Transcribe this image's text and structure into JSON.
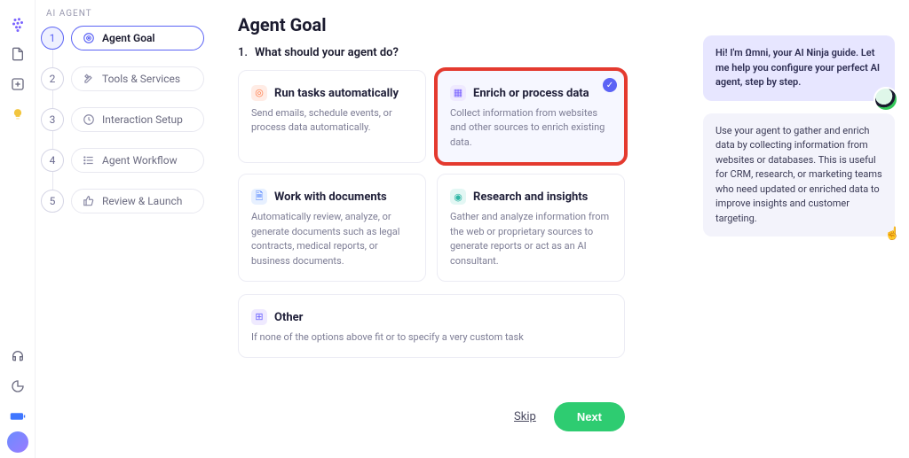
{
  "brand": "AI AGENT",
  "steps": [
    {
      "num": "1",
      "label": "Agent Goal",
      "icon": "target"
    },
    {
      "num": "2",
      "label": "Tools & Services",
      "icon": "tools"
    },
    {
      "num": "3",
      "label": "Interaction Setup",
      "icon": "clock"
    },
    {
      "num": "4",
      "label": "Agent Workflow",
      "icon": "list"
    },
    {
      "num": "5",
      "label": "Review & Launch",
      "icon": "thumbs"
    }
  ],
  "page": {
    "title": "Agent Goal",
    "question_num": "1.",
    "question": "What should your agent do?"
  },
  "options": {
    "run": {
      "title": "Run tasks automatically",
      "desc": "Send emails, schedule events, or process data automatically."
    },
    "enrich": {
      "title": "Enrich or process data",
      "desc": "Collect information from websites and other sources to enrich existing data."
    },
    "docs": {
      "title": "Work with documents",
      "desc": "Automatically review, analyze, or generate documents such as legal contracts, medical reports, or business documents."
    },
    "research": {
      "title": "Research and insights",
      "desc": "Gather and analyze information from the web or proprietary sources to generate reports or act as an AI consultant."
    },
    "other": {
      "title": "Other",
      "desc": "If none of the options above fit or to specify a very custom task"
    }
  },
  "actions": {
    "skip": "Skip",
    "next": "Next"
  },
  "assistant": {
    "intro": "Hi! I'm Ωmni, your AI Ninja guide. Let me help you configure your perfect AI agent, step by step.",
    "info": "Use your agent to gather and enrich data by collecting information from websites or databases. This is useful for CRM, research, or marketing teams who need updated or enriched data to improve insights and customer targeting."
  }
}
